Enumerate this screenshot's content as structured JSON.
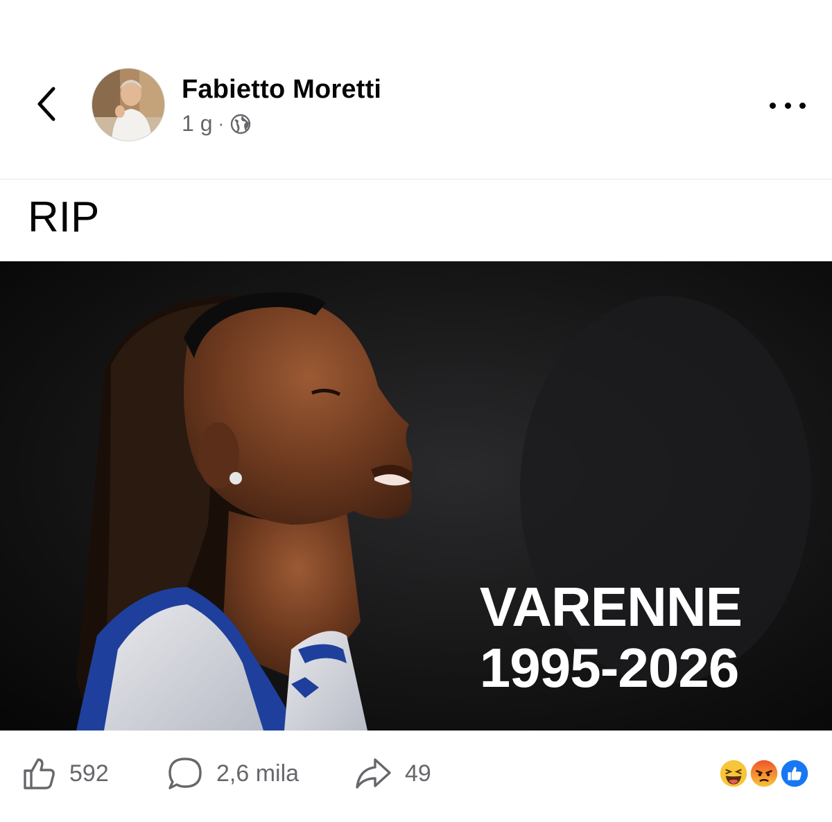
{
  "post": {
    "author": "Fabietto Moretti",
    "time": "1 g",
    "separator": "·",
    "audience_icon": "globe-icon",
    "text": "RIP",
    "image": {
      "overlay_line1": "VARENNE",
      "overlay_line2": "1995-2026"
    }
  },
  "footer": {
    "likes": "592",
    "comments": "2,6 mila",
    "shares": "49",
    "reactions": [
      "haha-emoji",
      "angry-emoji",
      "like-emoji"
    ]
  },
  "colors": {
    "text": "#050505",
    "secondary": "#65676b",
    "like_blue": "#1877f2",
    "angry": "#f0532a",
    "haha": "#f7c53a"
  }
}
